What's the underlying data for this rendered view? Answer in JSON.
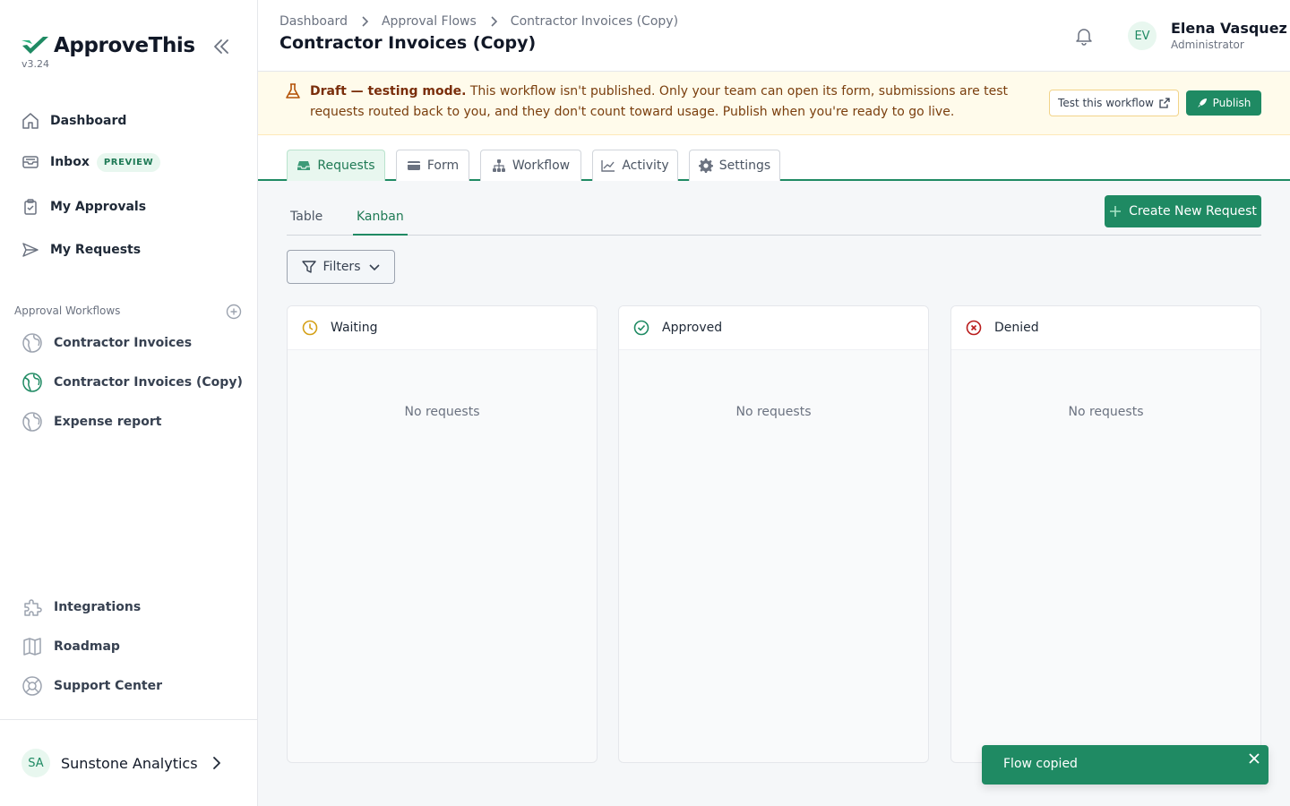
{
  "brand": {
    "name": "ApproveThis",
    "version": "v3.24",
    "accent": "#1f8a63"
  },
  "sidebar": {
    "collapse_icon": "double-chevron-left-icon",
    "nav": [
      {
        "label": "Dashboard",
        "icon": "home-icon"
      },
      {
        "label": "Inbox",
        "icon": "inbox-icon",
        "badge": "PREVIEW"
      },
      {
        "label": "My Approvals",
        "icon": "clipboard-check-icon"
      },
      {
        "label": "My Requests",
        "icon": "send-icon"
      }
    ],
    "workflows_label": "Approval Workflows",
    "workflows": [
      {
        "label": "Contractor Invoices",
        "active": false
      },
      {
        "label": "Contractor Invoices (Copy)",
        "active": true
      },
      {
        "label": "Expense report",
        "active": false
      }
    ],
    "bottom": [
      {
        "label": "Integrations",
        "icon": "puzzle-icon"
      },
      {
        "label": "Roadmap",
        "icon": "map-icon"
      },
      {
        "label": "Support Center",
        "icon": "lifebuoy-icon"
      }
    ],
    "org": {
      "initials": "SA",
      "name": "Sunstone Analytics"
    }
  },
  "header": {
    "breadcrumbs": [
      "Dashboard",
      "Approval Flows",
      "Contractor Invoices (Copy)"
    ],
    "title": "Contractor Invoices (Copy)",
    "user": {
      "initials": "EV",
      "name": "Elena Vasquez",
      "role": "Administrator"
    }
  },
  "banner": {
    "strong": "Draft — testing mode.",
    "text": " This workflow isn't published. Only your team can open its form, submissions are test requests routed back to you, and they don't count toward usage. Publish when you're ready to go live.",
    "test_label": "Test this workflow",
    "publish_label": "Publish"
  },
  "tabs": [
    {
      "label": "Requests",
      "icon": "inbox-tray-icon",
      "active": true
    },
    {
      "label": "Form",
      "icon": "card-icon",
      "active": false
    },
    {
      "label": "Workflow",
      "icon": "sitemap-icon",
      "active": false
    },
    {
      "label": "Activity",
      "icon": "chart-line-icon",
      "active": false
    },
    {
      "label": "Settings",
      "icon": "gear-icon",
      "active": false
    }
  ],
  "views": [
    {
      "label": "Table",
      "active": false
    },
    {
      "label": "Kanban",
      "active": true
    }
  ],
  "create_label": "Create New Request",
  "filters_label": "Filters",
  "columns": [
    {
      "name": "Waiting",
      "icon": "clock-icon",
      "color": "#d4a017",
      "empty": "No requests"
    },
    {
      "name": "Approved",
      "icon": "check-circle-icon",
      "color": "#1f8a63",
      "empty": "No requests"
    },
    {
      "name": "Denied",
      "icon": "x-circle-icon",
      "color": "#b91c1c",
      "empty": "No requests"
    }
  ],
  "toast": {
    "message": "Flow copied"
  }
}
